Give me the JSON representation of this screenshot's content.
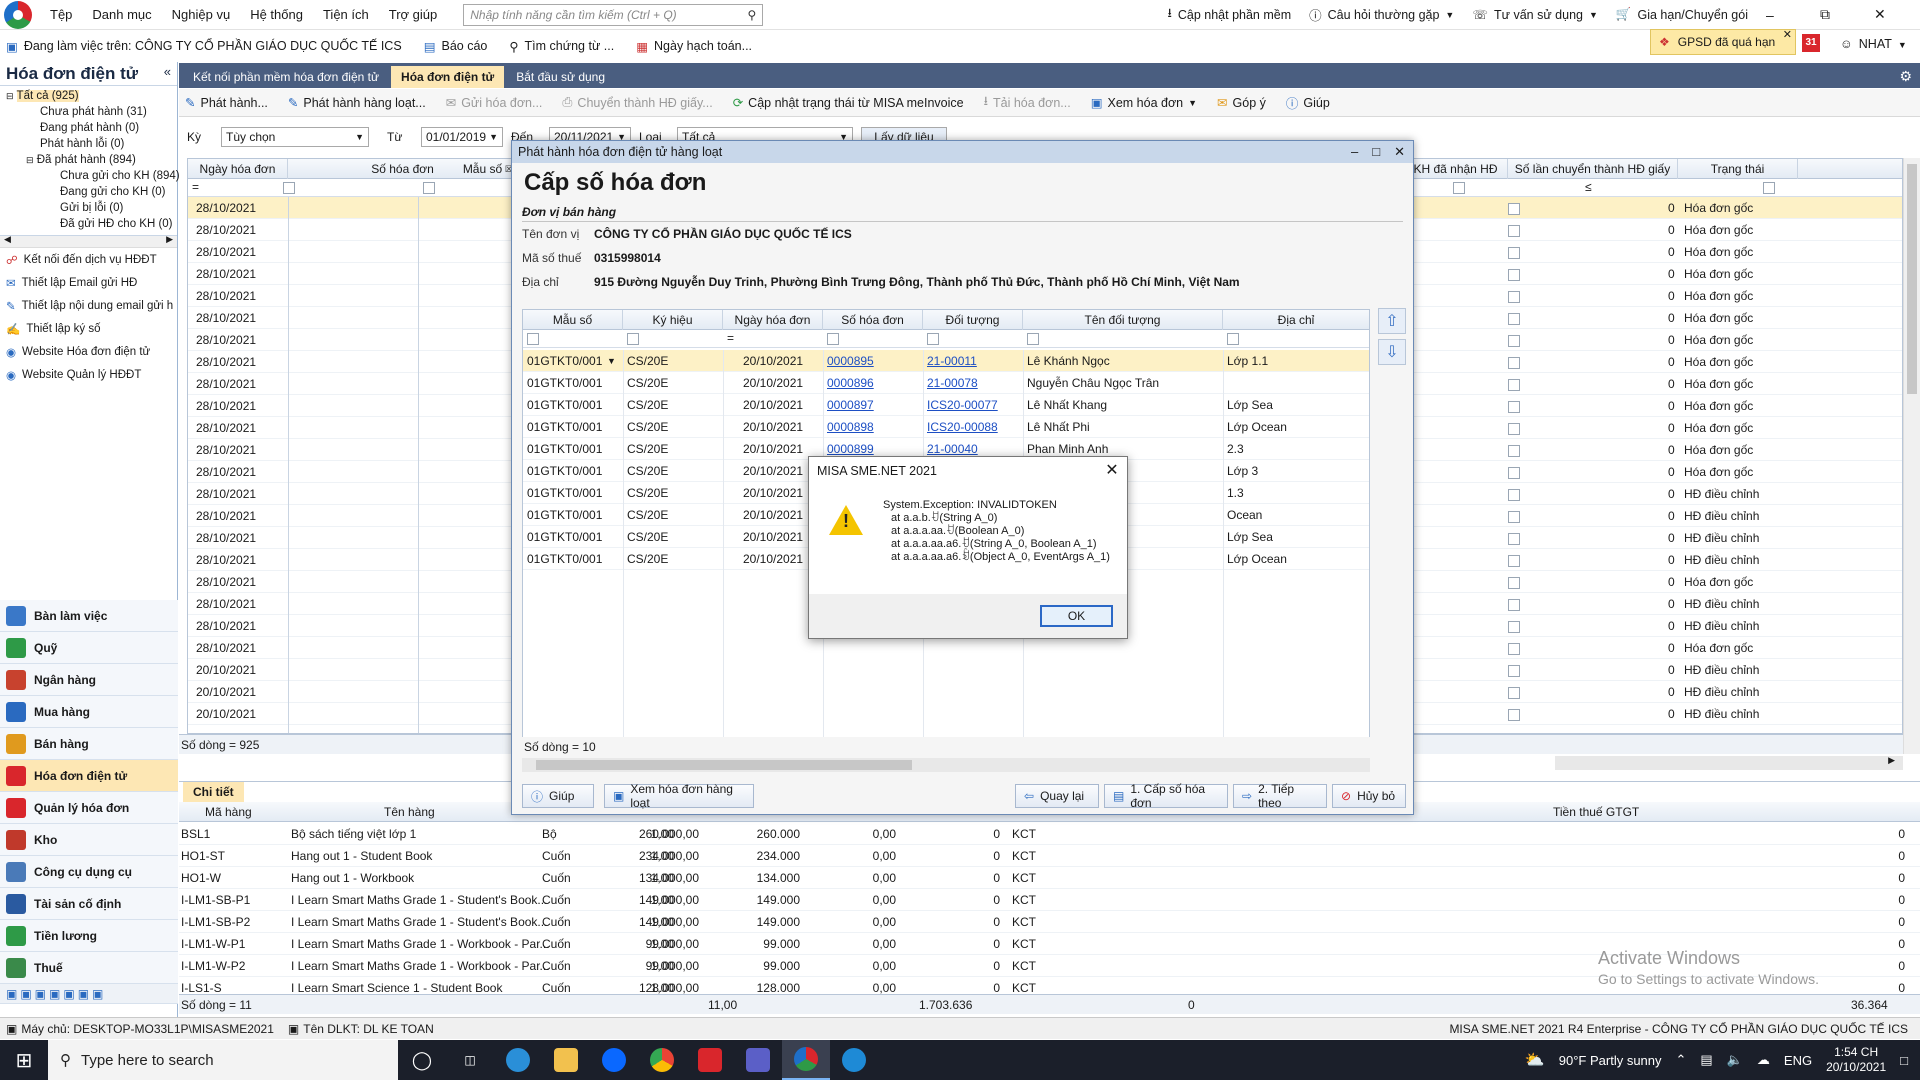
{
  "menubar": {
    "items": [
      "Tệp",
      "Danh mục",
      "Nghiệp vụ",
      "Hệ thống",
      "Tiện ích",
      "Trợ giúp"
    ],
    "search_placeholder": "Nhập tính năng cần tìm kiếm (Ctrl + Q)",
    "right": [
      "Cập nhật phần mềm",
      "Câu hỏi thường gặp",
      "Tư vấn sử dụng",
      "Gia hạn/Chuyển gói"
    ]
  },
  "toolbar2": {
    "working_on": "Đang làm việc trên: CÔNG TY CỔ PHẦN GIÁO DỤC QUỐC TẾ ICS",
    "report": "Báo cáo",
    "find_doc": "Tìm chứng từ ...",
    "posting_date": "Ngày hạch toán...",
    "gpsd": "GPSD đã quá hạn",
    "calendar_day": "31",
    "user": "NHAT"
  },
  "sidebar": {
    "title": "Hóa đơn điện tử",
    "tree": [
      "Tất cả (925)",
      "Chưa phát hành (31)",
      "Đang phát hành (0)",
      "Phát hành lỗi (0)",
      "Đã phát hành (894)",
      "Chưa gửi cho KH (894)",
      "Đang gửi cho KH (0)",
      "Gửi bị lỗi (0)",
      "Đã gửi HĐ cho KH (0)"
    ],
    "links": [
      "Kết nối đến dịch vụ HĐĐT",
      "Thiết lập Email gửi HĐ",
      "Thiết lập nội dung email gửi h",
      "Thiết lập ký số",
      "Website Hóa đơn điện tử",
      "Website Quản lý HĐĐT"
    ],
    "modules": [
      "Bàn làm việc",
      "Quỹ",
      "Ngân hàng",
      "Mua hàng",
      "Bán hàng",
      "Hóa đơn điện tử",
      "Quản lý hóa đơn",
      "Kho",
      "Công cụ dụng cụ",
      "Tài sản cố định",
      "Tiền lương",
      "Thuế"
    ]
  },
  "tabs": [
    "Kết nối phần mềm hóa đơn điện tử",
    "Hóa đơn điện tử",
    "Bắt đầu sử dụng"
  ],
  "actions": [
    "Phát hành...",
    "Phát hành hàng loạt...",
    "Gửi hóa đơn...",
    "Chuyển thành HĐ giấy...",
    "Cập nhật trạng thái từ MISA meInvoice",
    "Tải hóa đơn...",
    "Xem hóa đơn",
    "Góp ý",
    "Giúp"
  ],
  "filter": {
    "period_label": "Kỳ",
    "period": "Tùy chọn",
    "from_label": "Từ",
    "from": "01/01/2019",
    "to_label": "Đến",
    "to": "20/11/2021",
    "type_label": "Loại",
    "type": "Tất cả",
    "button": "Lấy dữ liệu"
  },
  "main_grid": {
    "headers": [
      "Ngày hóa đơn",
      "Số hóa đơn",
      "Mẫu số",
      "KH đã nhận HĐ",
      "Số lần chuyển thành HĐ giấy",
      "Trạng thái"
    ],
    "filter_ops": [
      "=",
      "≤"
    ],
    "rows": [
      [
        "28/10/2021",
        "0",
        "Hóa đơn gốc"
      ],
      [
        "28/10/2021",
        "0",
        "Hóa đơn gốc"
      ],
      [
        "28/10/2021",
        "0",
        "Hóa đơn gốc"
      ],
      [
        "28/10/2021",
        "0",
        "Hóa đơn gốc"
      ],
      [
        "28/10/2021",
        "0",
        "Hóa đơn gốc"
      ],
      [
        "28/10/2021",
        "0",
        "Hóa đơn gốc"
      ],
      [
        "28/10/2021",
        "0",
        "Hóa đơn gốc"
      ],
      [
        "28/10/2021",
        "0",
        "Hóa đơn gốc"
      ],
      [
        "28/10/2021",
        "0",
        "Hóa đơn gốc"
      ],
      [
        "28/10/2021",
        "0",
        "Hóa đơn gốc"
      ],
      [
        "28/10/2021",
        "0",
        "Hóa đơn gốc"
      ],
      [
        "28/10/2021",
        "0",
        "Hóa đơn gốc"
      ],
      [
        "28/10/2021",
        "0",
        "Hóa đơn gốc"
      ],
      [
        "28/10/2021",
        "0",
        "HĐ điều chỉnh"
      ],
      [
        "28/10/2021",
        "0",
        "HĐ điều chỉnh"
      ],
      [
        "28/10/2021",
        "0",
        "HĐ điều chỉnh"
      ],
      [
        "28/10/2021",
        "0",
        "HĐ điều chỉnh"
      ],
      [
        "28/10/2021",
        "0",
        "Hóa đơn gốc"
      ],
      [
        "28/10/2021",
        "0",
        "HĐ điều chỉnh"
      ],
      [
        "28/10/2021",
        "0",
        "HĐ điều chỉnh"
      ],
      [
        "28/10/2021",
        "0",
        "Hóa đơn gốc"
      ],
      [
        "20/10/2021",
        "0",
        "HĐ điều chỉnh"
      ],
      [
        "20/10/2021",
        "0",
        "HĐ điều chỉnh"
      ],
      [
        "20/10/2021",
        "0",
        "HĐ điều chỉnh"
      ]
    ],
    "footer": "Số dòng = 925"
  },
  "detail": {
    "tab": "Chi tiết",
    "headers": [
      "Mã hàng",
      "Tên hàng",
      "Tiền thuế GTGT"
    ],
    "rows": [
      [
        "BSL1",
        "Bộ sách tiếng việt lớp 1",
        "Bộ",
        "1,00",
        "260.000,00",
        "260.000",
        "0,00",
        "0",
        "KCT",
        "0"
      ],
      [
        "HO1-ST",
        "Hang out 1 - Student Book",
        "Cuốn",
        "1,00",
        "234.000,00",
        "234.000",
        "0,00",
        "0",
        "KCT",
        "0"
      ],
      [
        "HO1-W",
        "Hang out 1 - Workbook",
        "Cuốn",
        "1,00",
        "134.000,00",
        "134.000",
        "0,00",
        "0",
        "KCT",
        "0"
      ],
      [
        "I-LM1-SB-P1",
        "I Learn Smart Maths Grade 1 - Student's Book...",
        "Cuốn",
        "1,00",
        "149.000,00",
        "149.000",
        "0,00",
        "0",
        "KCT",
        "0"
      ],
      [
        "I-LM1-SB-P2",
        "I Learn Smart Maths Grade 1 - Student's Book...",
        "Cuốn",
        "1,00",
        "149.000,00",
        "149.000",
        "0,00",
        "0",
        "KCT",
        "0"
      ],
      [
        "I-LM1-W-P1",
        "I Learn Smart Maths Grade 1 - Workbook - Par...",
        "Cuốn",
        "1,00",
        "99.000,00",
        "99.000",
        "0,00",
        "0",
        "KCT",
        "0"
      ],
      [
        "I-LM1-W-P2",
        "I Learn Smart Maths Grade 1 - Workbook - Par...",
        "Cuốn",
        "1,00",
        "99.000,00",
        "99.000",
        "0,00",
        "0",
        "KCT",
        "0"
      ],
      [
        "I-LS1-S",
        "I Learn Smart Science 1 - Student Book",
        "Cuốn",
        "1,00",
        "128.000,00",
        "128.000",
        "0,00",
        "0",
        "KCT",
        "0"
      ]
    ],
    "footer": {
      "count": "Số dòng = 11",
      "qty": "11,00",
      "amount": "1.703.636",
      "tax": "0",
      "total": "36.364"
    }
  },
  "dialog": {
    "title": "Phát hành hóa đơn điện tử hàng loạt",
    "heading": "Cấp số hóa đơn",
    "section": "Đơn vị bán hàng",
    "unit_label": "Tên đơn vị",
    "unit": "CÔNG TY CỔ PHẦN GIÁO DỤC QUỐC TẾ ICS",
    "tax_label": "Mã số thuế",
    "tax": "0315998014",
    "addr_label": "Địa chỉ",
    "addr": "915 Đường Nguyễn Duy Trinh, Phường Bình Trưng Đông, Thành phố Thủ Đức, Thành phố Hồ Chí Minh, Việt Nam",
    "headers": [
      "Mẫu số",
      "Ký hiệu",
      "Ngày hóa đơn",
      "Số hóa đơn",
      "Đối tượng",
      "Tên đối tượng",
      "Địa chỉ"
    ],
    "rows": [
      [
        "01GTKT0/001",
        "CS/20E",
        "20/10/2021",
        "0000895",
        "21-00011",
        "Lê Khánh Ngọc",
        "Lớp 1.1"
      ],
      [
        "01GTKT0/001",
        "CS/20E",
        "20/10/2021",
        "0000896",
        "21-00078",
        "Nguyễn Châu Ngọc Trân",
        ""
      ],
      [
        "01GTKT0/001",
        "CS/20E",
        "20/10/2021",
        "0000897",
        "ICS20-00077",
        "Lê Nhất Khang",
        "Lớp Sea"
      ],
      [
        "01GTKT0/001",
        "CS/20E",
        "20/10/2021",
        "0000898",
        "ICS20-00088",
        "Lê Nhất Phi",
        "Lớp Ocean"
      ],
      [
        "01GTKT0/001",
        "CS/20E",
        "20/10/2021",
        "0000899",
        "21-00040",
        "Phan Minh Anh",
        "2.3"
      ],
      [
        "01GTKT0/001",
        "CS/20E",
        "20/10/2021",
        "",
        "",
        "",
        "Lớp 3"
      ],
      [
        "01GTKT0/001",
        "CS/20E",
        "20/10/2021",
        "",
        "",
        "",
        "1.3"
      ],
      [
        "01GTKT0/001",
        "CS/20E",
        "20/10/2021",
        "",
        "",
        "",
        "Ocean"
      ],
      [
        "01GTKT0/001",
        "CS/20E",
        "20/10/2021",
        "",
        "",
        "nh",
        "Lớp Sea"
      ],
      [
        "01GTKT0/001",
        "CS/20E",
        "20/10/2021",
        "",
        "",
        "",
        "Lớp Ocean"
      ]
    ],
    "footer": "Số dòng = 10",
    "buttons": [
      "Giúp",
      "Xem hóa đơn hàng loạt",
      "Quay lại",
      "1. Cấp số hóa đơn",
      "2. Tiếp theo",
      "Hủy bỏ"
    ]
  },
  "msgbox": {
    "title": "MISA SME.NET 2021",
    "lines": [
      "System.Exception: INVALIDTOKEN",
      "at a.a.b.ꀀ(String A_0)",
      "at a.a.a.aa.ꀀ(Boolean A_0)",
      "at a.a.a.aa.a6.ꀀ(String A_0, Boolean A_1)",
      "at a.a.a.aa.a6.ꀁ(Object A_0, EventArgs A_1)"
    ],
    "ok": "OK"
  },
  "status": {
    "server": "Máy chủ: DESKTOP-MO33L1P\\MISASME2021",
    "dlkt": "Tên DLKT: DL KE TOAN",
    "right": "MISA SME.NET 2021 R4 Enterprise - CÔNG TY CỔ PHẦN GIÁO DỤC QUỐC TẾ ICS"
  },
  "watermark": {
    "line1": "Activate Windows",
    "line2": "Go to Settings to activate Windows."
  },
  "taskbar": {
    "search": "Type here to search",
    "weather": "90°F  Partly sunny",
    "lang": "ENG",
    "time": "1:54 CH",
    "date": "20/10/2021"
  },
  "colors": {
    "accent": "#fde7b4",
    "tabbar": "#4a5e80",
    "link": "#1d4fc4",
    "warning": "#f4c400"
  }
}
